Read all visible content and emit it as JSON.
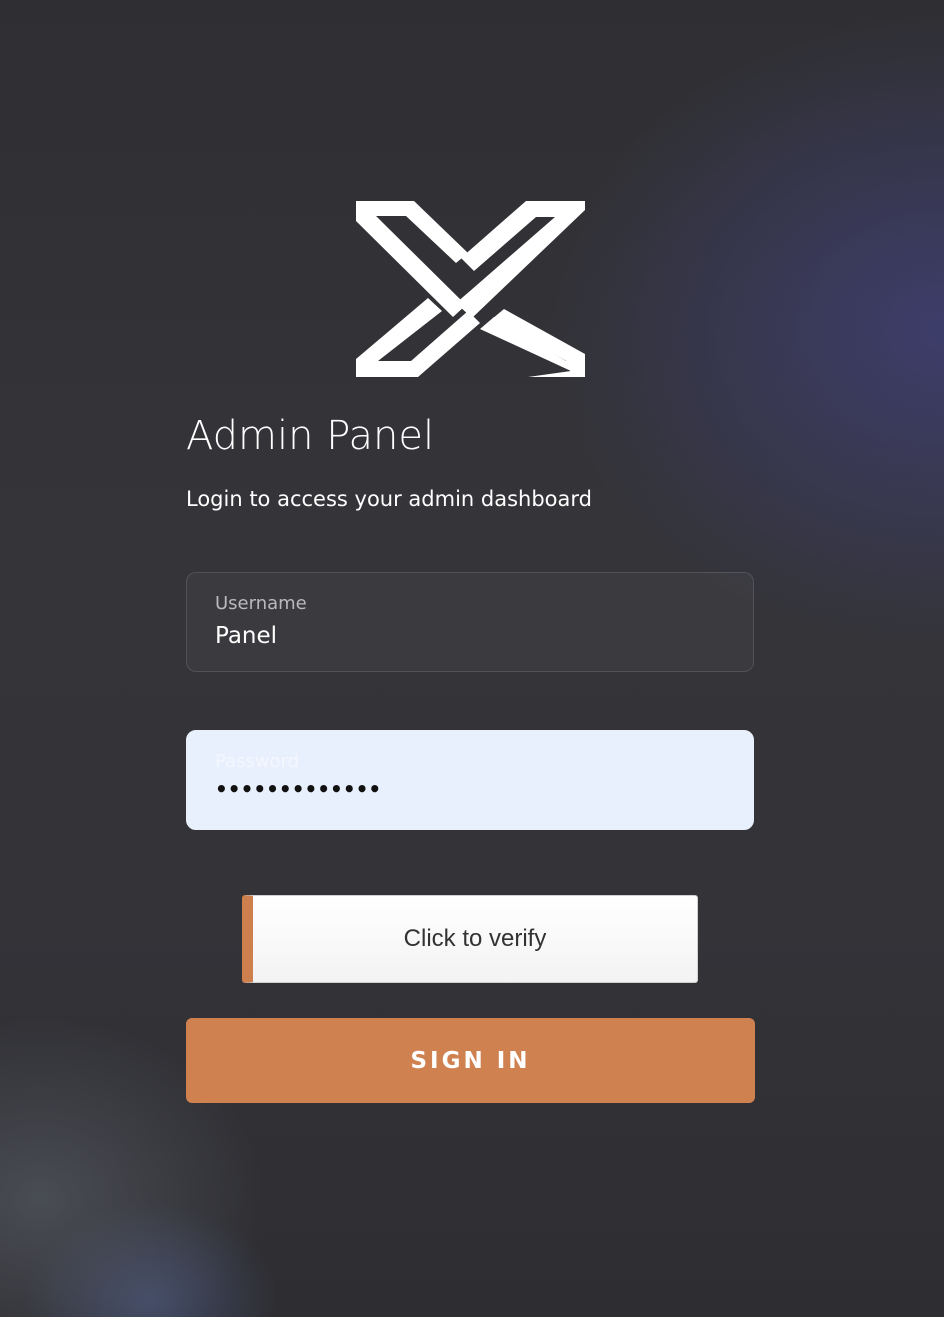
{
  "brand": {
    "logo_icon": "x-logo-icon",
    "logo_color": "#ffffff"
  },
  "header": {
    "title": "Admin Panel",
    "subtitle": "Login to access your admin dashboard"
  },
  "form": {
    "username": {
      "label": "Username",
      "value": "Panel"
    },
    "password": {
      "label": "Password",
      "value": "•••••••••••••"
    },
    "verify": {
      "label": "Click to verify",
      "accent_color": "#cd7f4e"
    },
    "submit": {
      "label": "SIGN IN",
      "color": "#cf8150"
    }
  }
}
